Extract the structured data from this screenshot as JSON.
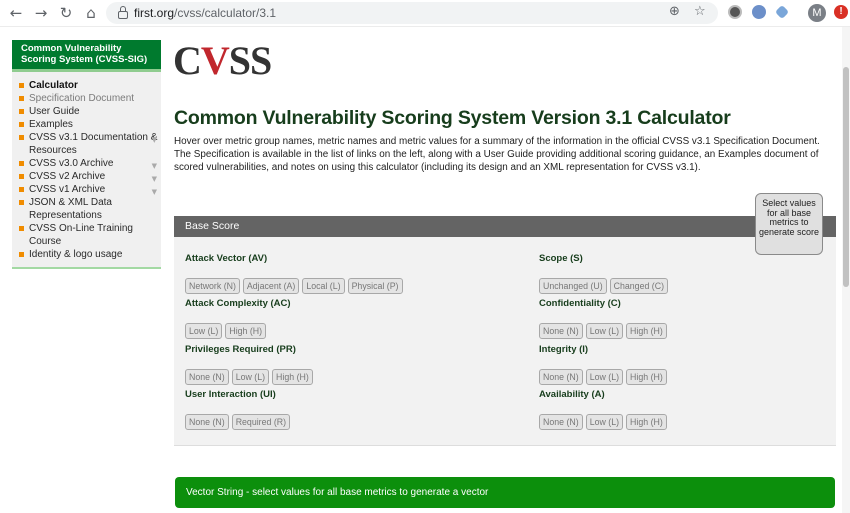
{
  "browser": {
    "url_domain": "first.org",
    "url_path": "/cvss/calculator/3.1",
    "back_icon": "←",
    "forward_icon": "→",
    "reload_icon": "↻",
    "home_icon": "⌂",
    "zoom_icon": "⊕",
    "star_icon": "☆",
    "avatar_letter": "M",
    "alert_icon": "!"
  },
  "sidebar": {
    "header": "Common Vulnerability Scoring System (CVSS-SIG)",
    "items": [
      {
        "label": "Calculator"
      },
      {
        "label": "Specification Document"
      },
      {
        "label": "User Guide"
      },
      {
        "label": "Examples"
      },
      {
        "label": "CVSS v3.1 Documentation & Resources",
        "caret": "▼"
      },
      {
        "label": "CVSS v3.0 Archive",
        "caret": "▼"
      },
      {
        "label": "CVSS v2 Archive",
        "caret": "▼"
      },
      {
        "label": "CVSS v1 Archive",
        "caret": "▼"
      },
      {
        "label": "JSON & XML Data Representations"
      },
      {
        "label": "CVSS On-Line Training Course"
      },
      {
        "label": "Identity & logo usage"
      }
    ]
  },
  "logo": {
    "c": "C",
    "v": "V",
    "ss": "SS"
  },
  "main": {
    "title": "Common Vulnerability Scoring System Version 3.1 Calculator",
    "intro": "Hover over metric group names, metric names and metric values for a summary of the information in the official CVSS v3.1 Specification Document. The Specification is available in the list of links on the left, along with a User Guide providing additional scoring guidance, an Examples document of scored vulnerabilities, and notes on using this calculator (including its design and an XML representation for CVSS v3.1).",
    "panel_title": "Base Score",
    "score_hint": "Select values for all base metrics to generate score",
    "metrics": {
      "av": {
        "label": "Attack Vector (AV)",
        "options": [
          "Network (N)",
          "Adjacent (A)",
          "Local (L)",
          "Physical (P)"
        ]
      },
      "ac": {
        "label": "Attack Complexity (AC)",
        "options": [
          "Low (L)",
          "High (H)"
        ]
      },
      "pr": {
        "label": "Privileges Required (PR)",
        "options": [
          "None (N)",
          "Low (L)",
          "High (H)"
        ]
      },
      "ui": {
        "label": "User Interaction (UI)",
        "options": [
          "None (N)",
          "Required (R)"
        ]
      },
      "s": {
        "label": "Scope (S)",
        "options": [
          "Unchanged (U)",
          "Changed (C)"
        ]
      },
      "c": {
        "label": "Confidentiality (C)",
        "options": [
          "None (N)",
          "Low (L)",
          "High (H)"
        ]
      },
      "i": {
        "label": "Integrity (I)",
        "options": [
          "None (N)",
          "Low (L)",
          "High (H)"
        ]
      },
      "a": {
        "label": "Availability (A)",
        "options": [
          "None (N)",
          "Low (L)",
          "High (H)"
        ]
      }
    },
    "vector_string": "Vector String - select values for all base metrics to generate a vector"
  }
}
